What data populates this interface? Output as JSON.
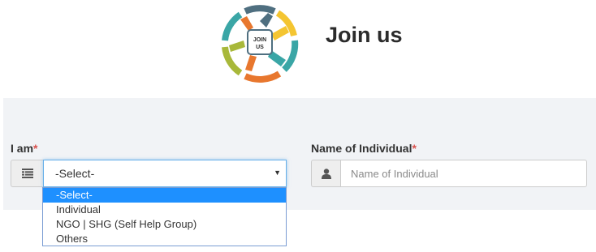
{
  "header": {
    "title": "Join us",
    "logo_text_line1": "JOIN",
    "logo_text_line2": "US"
  },
  "form": {
    "i_am": {
      "label": "I am",
      "required_mark": "*",
      "icon": "list-icon",
      "selected": "-Select-",
      "options": [
        "-Select-",
        "Individual",
        "NGO | SHG (Self Help Group)",
        "Others"
      ],
      "highlighted_option": "-Select-"
    },
    "name": {
      "label": "Name of Individual",
      "required_mark": "*",
      "icon": "user-icon",
      "placeholder": "Name of Individual",
      "value": ""
    }
  },
  "colors": {
    "panel_bg": "#f1f3f6",
    "required": "#d9534f",
    "highlight": "#1e90ff",
    "focus_border": "#66afe9",
    "logo_teal": "#3aa6a6",
    "logo_orange": "#e8772e",
    "logo_yellow": "#f4c531",
    "logo_green": "#a8b83a",
    "logo_slate": "#4f6f80"
  }
}
